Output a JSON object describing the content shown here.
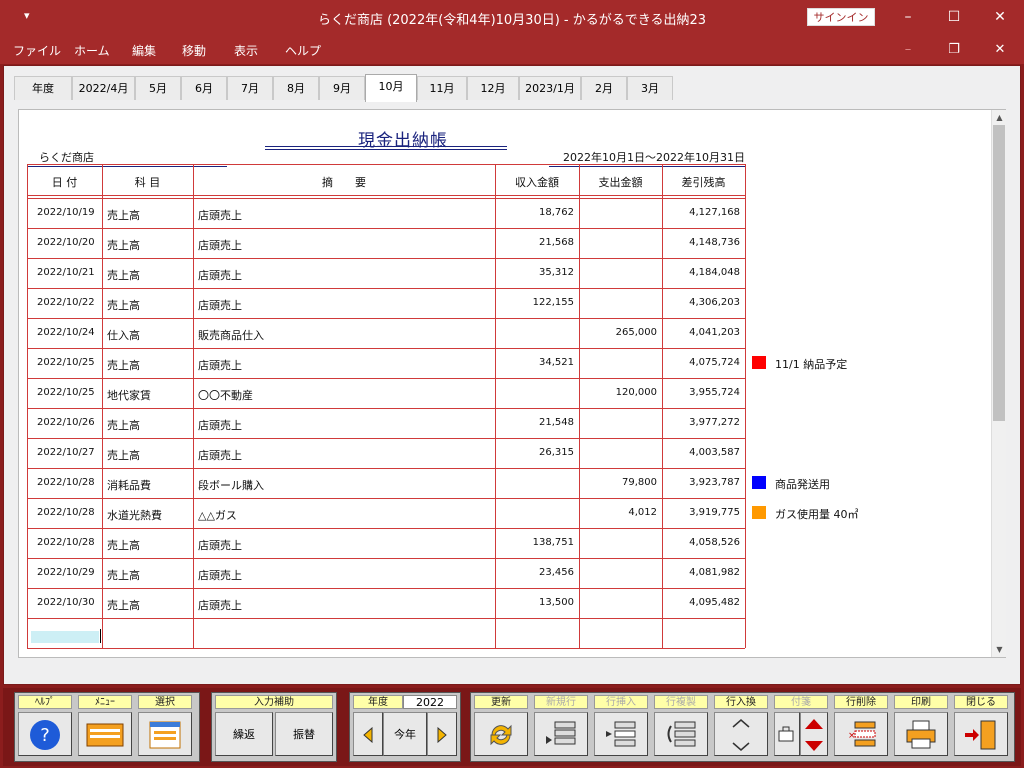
{
  "window": {
    "title": "らくだ商店 (2022年(令和4年)10月30日) - かるがるできる出納23",
    "signin": "サインイン"
  },
  "menu": [
    "ファイル",
    "ホーム",
    "編集",
    "移動",
    "表示",
    "ヘルプ"
  ],
  "tabs": [
    "年度",
    "2022/4月",
    "5月",
    "6月",
    "7月",
    "8月",
    "9月",
    "10月",
    "11月",
    "12月",
    "2023/1月",
    "2月",
    "3月"
  ],
  "active_tab": "10月",
  "ledger": {
    "title": "現金出納帳",
    "company": "らくだ商店",
    "period": "2022年10月1日～2022年10月31日",
    "headers": [
      "日 付",
      "科 目",
      "摘　　要",
      "収入金額",
      "支出金額",
      "差引残高"
    ],
    "rows": [
      {
        "date": "2022/10/19",
        "account": "売上高",
        "desc": "店頭売上",
        "income": "18,762",
        "expense": "",
        "balance": "4,127,168"
      },
      {
        "date": "2022/10/20",
        "account": "売上高",
        "desc": "店頭売上",
        "income": "21,568",
        "expense": "",
        "balance": "4,148,736"
      },
      {
        "date": "2022/10/21",
        "account": "売上高",
        "desc": "店頭売上",
        "income": "35,312",
        "expense": "",
        "balance": "4,184,048"
      },
      {
        "date": "2022/10/22",
        "account": "売上高",
        "desc": "店頭売上",
        "income": "122,155",
        "expense": "",
        "balance": "4,306,203"
      },
      {
        "date": "2022/10/24",
        "account": "仕入高",
        "desc": "販売商品仕入",
        "income": "",
        "expense": "265,000",
        "balance": "4,041,203"
      },
      {
        "date": "2022/10/25",
        "account": "売上高",
        "desc": "店頭売上",
        "income": "34,521",
        "expense": "",
        "balance": "4,075,724"
      },
      {
        "date": "2022/10/25",
        "account": "地代家賃",
        "desc": "〇〇不動産",
        "income": "",
        "expense": "120,000",
        "balance": "3,955,724"
      },
      {
        "date": "2022/10/26",
        "account": "売上高",
        "desc": "店頭売上",
        "income": "21,548",
        "expense": "",
        "balance": "3,977,272"
      },
      {
        "date": "2022/10/27",
        "account": "売上高",
        "desc": "店頭売上",
        "income": "26,315",
        "expense": "",
        "balance": "4,003,587"
      },
      {
        "date": "2022/10/28",
        "account": "消耗品費",
        "desc": "段ボール購入",
        "income": "",
        "expense": "79,800",
        "balance": "3,923,787"
      },
      {
        "date": "2022/10/28",
        "account": "水道光熱費",
        "desc": "△△ガス",
        "income": "",
        "expense": "4,012",
        "balance": "3,919,775"
      },
      {
        "date": "2022/10/28",
        "account": "売上高",
        "desc": "店頭売上",
        "income": "138,751",
        "expense": "",
        "balance": "4,058,526"
      },
      {
        "date": "2022/10/29",
        "account": "売上高",
        "desc": "店頭売上",
        "income": "23,456",
        "expense": "",
        "balance": "4,081,982"
      },
      {
        "date": "2022/10/30",
        "account": "売上高",
        "desc": "店頭売上",
        "income": "13,500",
        "expense": "",
        "balance": "4,095,482"
      }
    ]
  },
  "notes": [
    {
      "row": 5,
      "color": "#ff0000",
      "text": "11/1 納品予定"
    },
    {
      "row": 9,
      "color": "#0000ff",
      "text": "商品発送用"
    },
    {
      "row": 10,
      "color": "#ff9900",
      "text": "ガス使用量 40㎥"
    }
  ],
  "toolbar": {
    "help": "ﾍﾙﾌﾟ",
    "menu": "ﾒﾆｭｰ",
    "select": "選択",
    "input_assist": "入力補助",
    "repeat": "繰返",
    "transfer": "振替",
    "year_label": "年度",
    "year_value": "2022",
    "this_year": "今年",
    "refresh": "更新",
    "new_row": "新規行",
    "insert_row": "行挿入",
    "copy_row": "行複製",
    "swap_row": "行入換",
    "sticky": "付箋",
    "delete_row": "行削除",
    "print": "印刷",
    "close": "閉じる"
  }
}
